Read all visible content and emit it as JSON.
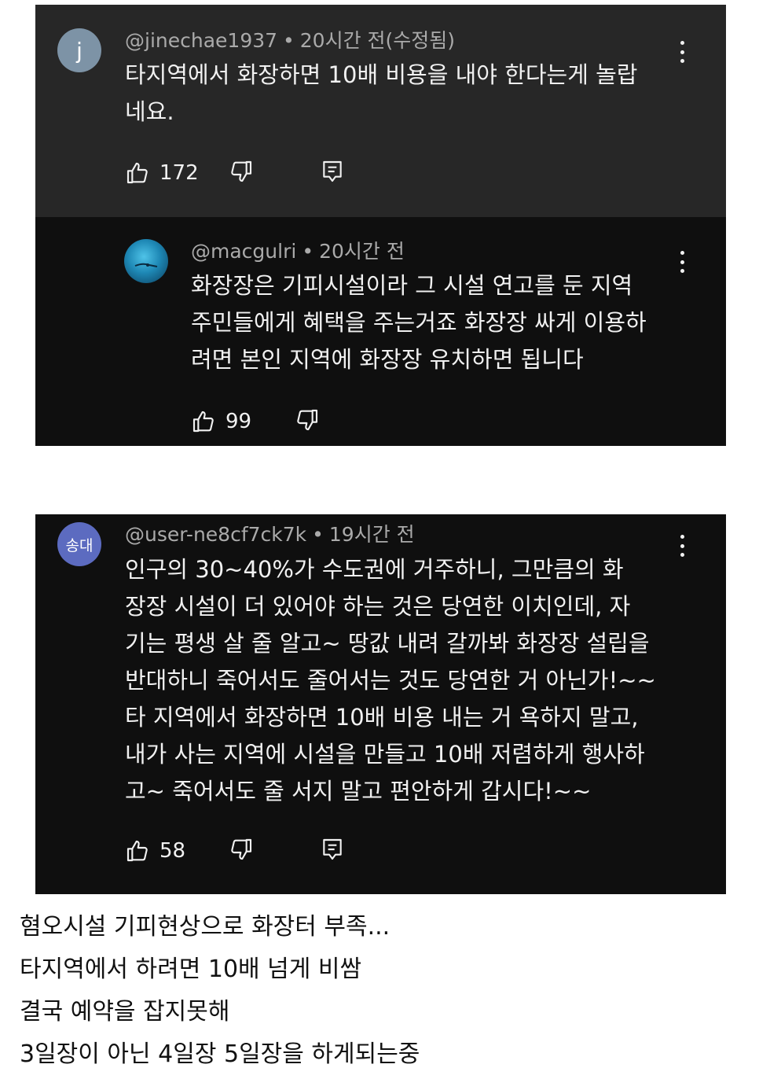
{
  "comments": [
    {
      "handle": "@jinechae1937",
      "time": "20시간 전(수정됨)",
      "avatar_letter": "j",
      "lines": [
        "타지역에서 화장하면 10배 비용을 내야 한다는게 놀랍",
        "네요."
      ],
      "likes": "172",
      "reply": {
        "handle": "@macgulri",
        "time": "20시간 전",
        "lines": [
          "화장장은 기피시설이라 그 시설 연고를 둔 지역",
          "주민들에게 혜택을 주는거죠 화장장 싸게 이용하",
          "려면 본인 지역에 화장장 유치하면 됩니다"
        ],
        "likes": "99"
      }
    },
    {
      "handle": "@user-ne8cf7ck7k",
      "time": "19시간 전",
      "avatar_letter": "송대",
      "lines": [
        "인구의 30~40%가 수도권에 거주하니,  그만큼의 화",
        "장장 시설이 더 있어야 하는 것은 당연한 이치인데,  자",
        "기는 평생 살 줄 알고~ 땅값 내려 갈까봐 화장장 설립을",
        "반대하니 죽어서도 줄어서는 것도 당연한 거 아닌가!~~",
        "타 지역에서 화장하면 10배 비용 내는 거 욕하지 말고,",
        "내가 사는 지역에 시설을 만들고 10배 저렴하게 행사하",
        "고~ 죽어서도 줄 서지 말고 편안하게 갑시다!~~"
      ],
      "likes": "58"
    }
  ],
  "caption": [
    "혐오시설 기피현상으로 화장터 부족...",
    "타지역에서 하려면 10배 넘게 비쌈",
    "결국 예약을 잡지못해",
    "3일장이 아닌 4일장 5일장을 하게되는중"
  ],
  "colors": {
    "card_bg": "#0f0f0f",
    "highlight_bg": "#272727",
    "text": "#f1f1f1",
    "meta": "#aaaaaa",
    "avatar_j": "#7d93a6",
    "avatar_user": "#5c6bc0"
  },
  "icons": [
    "thumbs-up-icon",
    "thumbs-down-icon",
    "reply-icon",
    "more-vert-icon"
  ]
}
